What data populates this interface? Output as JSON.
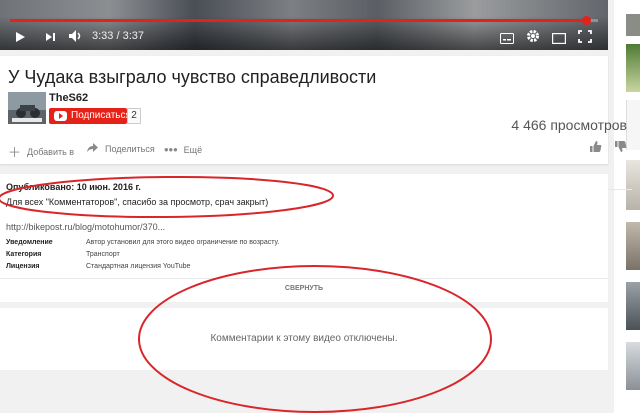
{
  "player": {
    "time": "3:33 / 3:37",
    "progress_fraction": 0.98,
    "colors": {
      "accent": "#e62117"
    }
  },
  "video": {
    "title": "У Чудака взыграло чувство справедливости",
    "channel": "TheS62",
    "subscribe_label": "Подписаться",
    "subscriber_count": "2",
    "views": "4 466 просмотров",
    "actions": {
      "add": "Добавить в",
      "share": "Поделиться",
      "more": "Ещё"
    }
  },
  "description": {
    "published": "Опубликовано: 10 июн. 2016 г.",
    "text": "Для всех \"Комментаторов\", спасибо за просмотр, срач закрыт)",
    "link": "http://bikepost.ru/blog/motohumor/370...",
    "meta": [
      {
        "key": "Уведомление",
        "value": "Автор установил для этого видео ограничение по возрасту."
      },
      {
        "key": "Категория",
        "value": "Транспорт"
      },
      {
        "key": "Лицензия",
        "value": "Стандартная лицензия YouTube"
      }
    ],
    "collapse_label": "СВЕРНУТЬ"
  },
  "comments": {
    "disabled_text": "Комментарии к этому видео отключены."
  },
  "icons": [
    "play-icon",
    "next-icon",
    "volume-icon",
    "subtitles-icon",
    "settings-icon",
    "miniplayer-icon",
    "fullscreen-icon",
    "add-icon",
    "share-icon",
    "more-icon",
    "like-icon",
    "dislike-icon"
  ]
}
